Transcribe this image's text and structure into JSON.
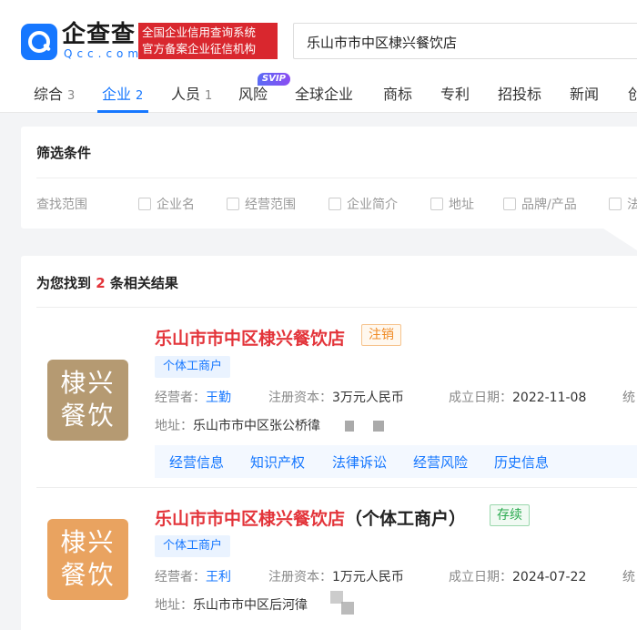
{
  "header": {
    "logo_text": "企查查",
    "logo_domain": "Qcc.com",
    "badge_line1": "全国企业信用查询系统",
    "badge_line2": "官方备案企业征信机构",
    "search_value": "乐山市市中区棣兴餐饮店"
  },
  "tabs": [
    {
      "label": "综合",
      "count": "3"
    },
    {
      "label": "企业",
      "count": "2"
    },
    {
      "label": "人员",
      "count": "1"
    },
    {
      "label": "风险",
      "badge": "SVIP"
    },
    {
      "label": "全球企业"
    },
    {
      "label": "商标"
    },
    {
      "label": "专利"
    },
    {
      "label": "招投标"
    },
    {
      "label": "新闻"
    },
    {
      "label": "创"
    }
  ],
  "filter": {
    "title": "筛选条件",
    "scope_label": "查找范围",
    "options": [
      "企业名",
      "经营范围",
      "企业简介",
      "地址",
      "品牌/产品",
      "法"
    ]
  },
  "results_header": {
    "prefix": "为您找到",
    "count": "2",
    "suffix": "条相关结果"
  },
  "results": [
    {
      "avatar_line1": "棣兴",
      "avatar_line2": "餐饮",
      "avatar_color": "#b59a72",
      "name": "乐山市市中区棣兴餐饮店",
      "name_suffix": "",
      "status": "注销",
      "tag": "个体工商户",
      "operator_label": "经营者：",
      "operator": "王勤",
      "capital_label": "注册资本：",
      "capital": "3万元人民币",
      "date_label": "成立日期：",
      "date": "2022-11-08",
      "extra_label": "统",
      "address_label": "地址：",
      "address": "乐山市市中区张公桥徫",
      "actions": [
        "经营信息",
        "知识产权",
        "法律诉讼",
        "经营风险",
        "历史信息"
      ]
    },
    {
      "avatar_line1": "棣兴",
      "avatar_line2": "餐饮",
      "avatar_color": "#e9a360",
      "name": "乐山市市中区棣兴餐饮店",
      "name_suffix": "（个体工商户）",
      "status": "存续",
      "tag": "个体工商户",
      "operator_label": "经营者：",
      "operator": "王利",
      "capital_label": "注册资本：",
      "capital": "1万元人民币",
      "date_label": "成立日期：",
      "date": "2024-07-22",
      "extra_label": "统",
      "address_label": "地址：",
      "address": "乐山市市中区后河徫"
    }
  ],
  "colors": {
    "brand_blue": "#1677ff",
    "brand_red": "#d9272e",
    "name_red": "#e3343a"
  }
}
